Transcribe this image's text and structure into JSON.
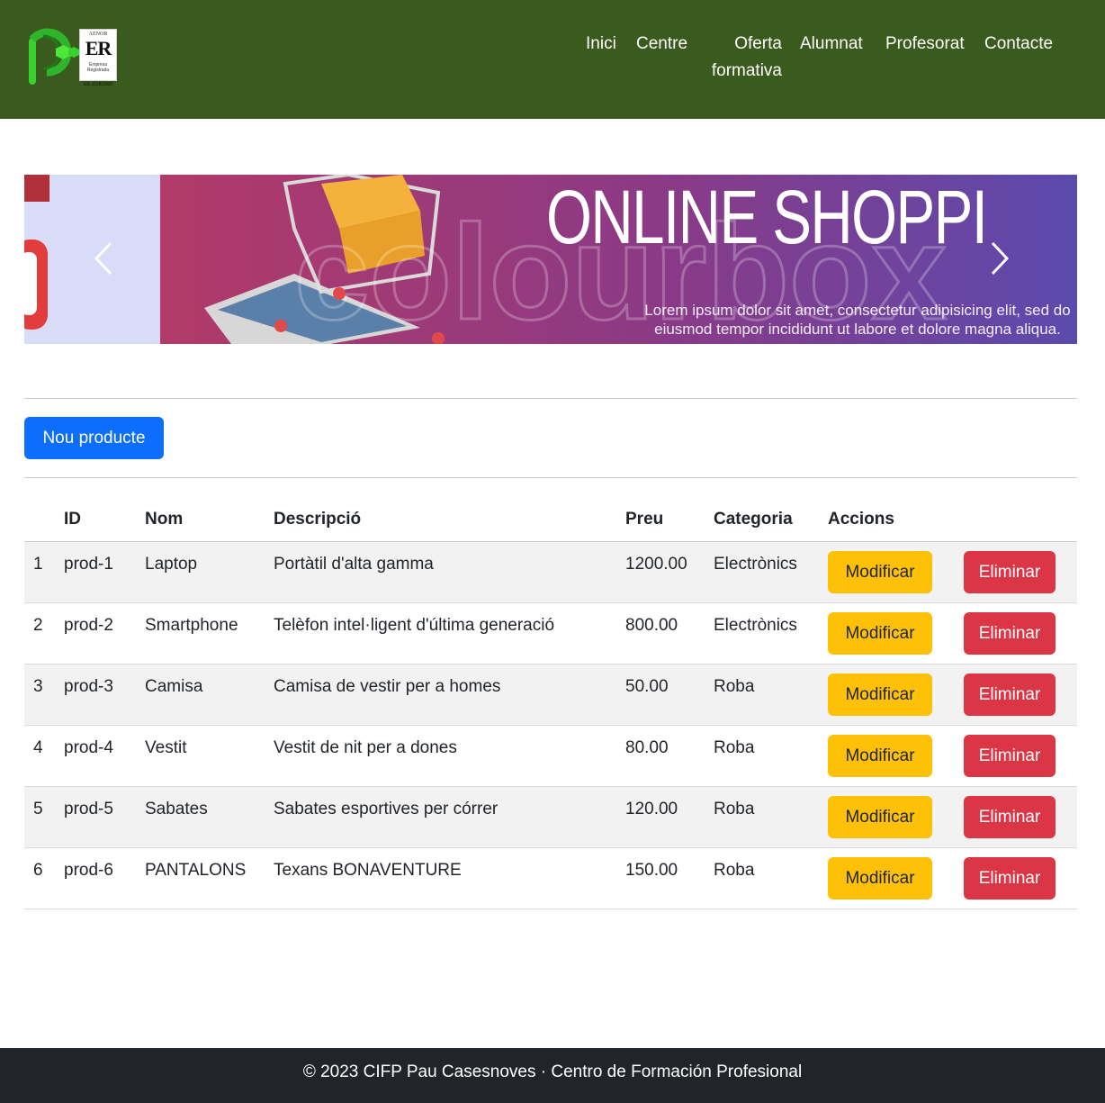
{
  "header": {
    "logo_alt": "CIFP Pau Casesnoves",
    "cert": {
      "top": "AENOR",
      "mark": "ER",
      "sub1": "Empresa",
      "sub2": "Registrada",
      "code": "ER-1128/2000"
    },
    "nav": [
      {
        "label": "Inici"
      },
      {
        "label": "Centre"
      },
      {
        "label_line1": "Oferta",
        "label_line2": "formativa"
      },
      {
        "label": "Alumnat"
      },
      {
        "label": "Profesorat"
      },
      {
        "label": "Contacte"
      }
    ],
    "colors": {
      "background": "#3a5a1e",
      "text": "#ffffff"
    }
  },
  "carousel": {
    "title": "ONLINE SHOPPI",
    "caption_line1": "Lorem ipsum dolor sit amet, consectetur adipisicing elit, sed do",
    "caption_line2": "eiusmod tempor incididunt ut labore et dolore magna aliqua.",
    "watermark": "colourbox",
    "prev_icon": "chevron-left-icon",
    "next_icon": "chevron-right-icon"
  },
  "actions": {
    "new_product_label": "Nou producte"
  },
  "table": {
    "headers": {
      "index": "",
      "id": "ID",
      "name": "Nom",
      "description": "Descripció",
      "price": "Preu",
      "category": "Categoria",
      "actions": "Accions"
    },
    "rows": [
      {
        "index": "1",
        "id": "prod-1",
        "name": "Laptop",
        "description": "Portàtil d'alta gamma",
        "price": "1200.00",
        "category": "Electrònics"
      },
      {
        "index": "2",
        "id": "prod-2",
        "name": "Smartphone",
        "description": "Telèfon intel·ligent d'última generació",
        "price": "800.00",
        "category": "Electrònics"
      },
      {
        "index": "3",
        "id": "prod-3",
        "name": "Camisa",
        "description": "Camisa de vestir per a homes",
        "price": "50.00",
        "category": "Roba"
      },
      {
        "index": "4",
        "id": "prod-4",
        "name": "Vestit",
        "description": "Vestit de nit per a dones",
        "price": "80.00",
        "category": "Roba"
      },
      {
        "index": "5",
        "id": "prod-5",
        "name": "Sabates",
        "description": "Sabates esportives per córrer",
        "price": "120.00",
        "category": "Roba"
      },
      {
        "index": "6",
        "id": "prod-6",
        "name": "PANTALONS",
        "description": "Texans BONAVENTURE",
        "price": "150.00",
        "category": "Roba"
      }
    ],
    "row_actions": {
      "edit_label": "Modificar",
      "delete_label": "Eliminar"
    },
    "colors": {
      "edit": "#ffc107",
      "delete": "#dc3545",
      "primary": "#0d6efd"
    }
  },
  "footer": {
    "text": "© 2023 CIFP Pau Casesnoves · Centro de Formación Profesional"
  }
}
